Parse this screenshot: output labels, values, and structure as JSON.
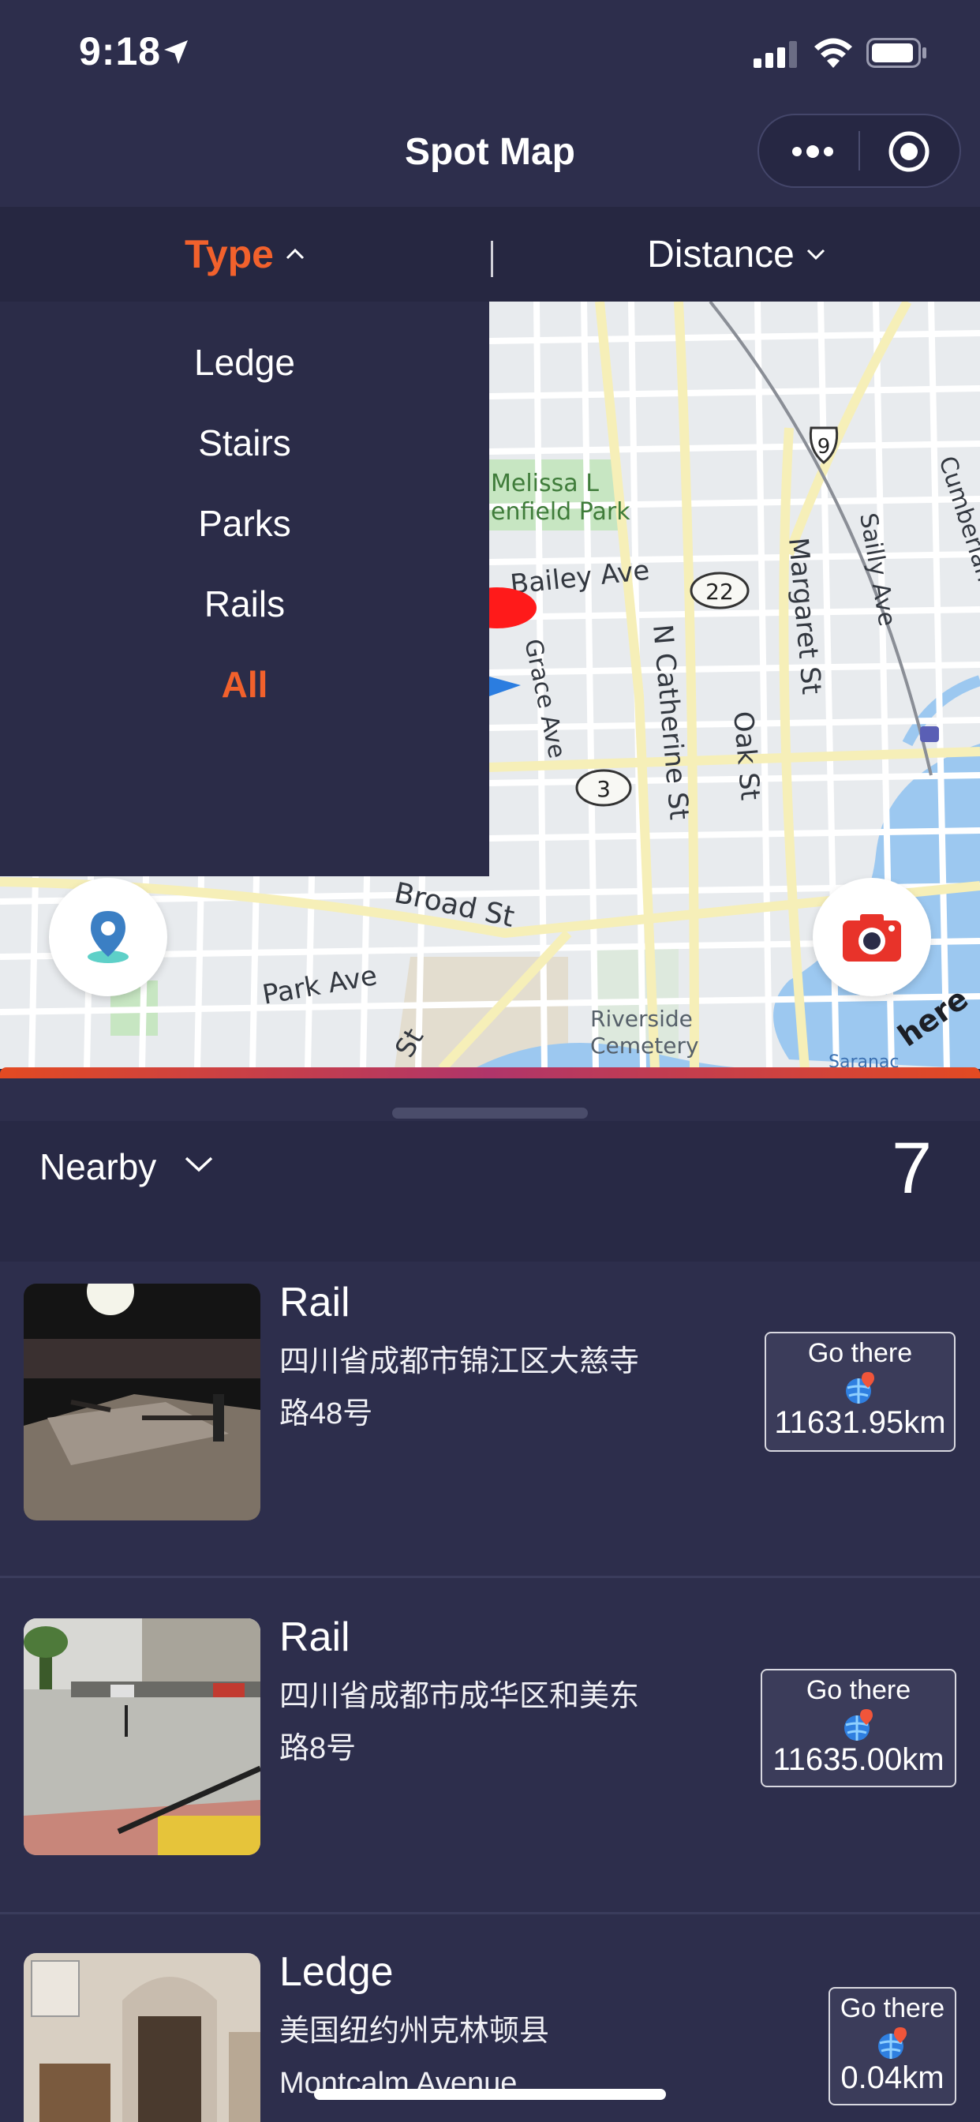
{
  "status_bar": {
    "time": "9:18"
  },
  "nav": {
    "title": "Spot Map"
  },
  "filter": {
    "type_label": "Type",
    "distance_label": "Distance"
  },
  "type_menu": {
    "items": [
      "Ledge",
      "Stairs",
      "Parks",
      "Rails",
      "All"
    ],
    "selected": "All"
  },
  "map": {
    "labels": {
      "park_line1": "Melissa L",
      "park_line2": "enfield Park",
      "bailey": "Bailey Ave",
      "route22": "22",
      "route9": "9",
      "route3": "3",
      "grace": "Grace Ave",
      "catherine": "N Catherine St",
      "oak": "Oak St",
      "margaret": "Margaret St",
      "sailly": "Sailly Ave",
      "cumberland": "Cumberland Ave",
      "broad": "Broad St",
      "park_ave": "Park Ave",
      "st": "St",
      "riverside1": "Riverside",
      "riverside2": "Cemetery",
      "saranac": "Saranac",
      "here": "here"
    }
  },
  "nearby": {
    "label": "Nearby",
    "count": "7"
  },
  "spots": [
    {
      "title": "Rail",
      "address": "四川省成都市锦江区大慈寺路48号",
      "go_label": "Go there",
      "distance": "11631.95km"
    },
    {
      "title": "Rail",
      "address": "四川省成都市成华区和美东路8号",
      "go_label": "Go there",
      "distance": "11635.00km"
    },
    {
      "title": "Ledge",
      "address": "美国纽约州克林顿县Montcalm Avenue",
      "go_label": "Go there",
      "distance": "0.04km"
    }
  ],
  "colors": {
    "accent": "#f2612c",
    "background": "#2d2e4c",
    "panel": "#262741"
  }
}
